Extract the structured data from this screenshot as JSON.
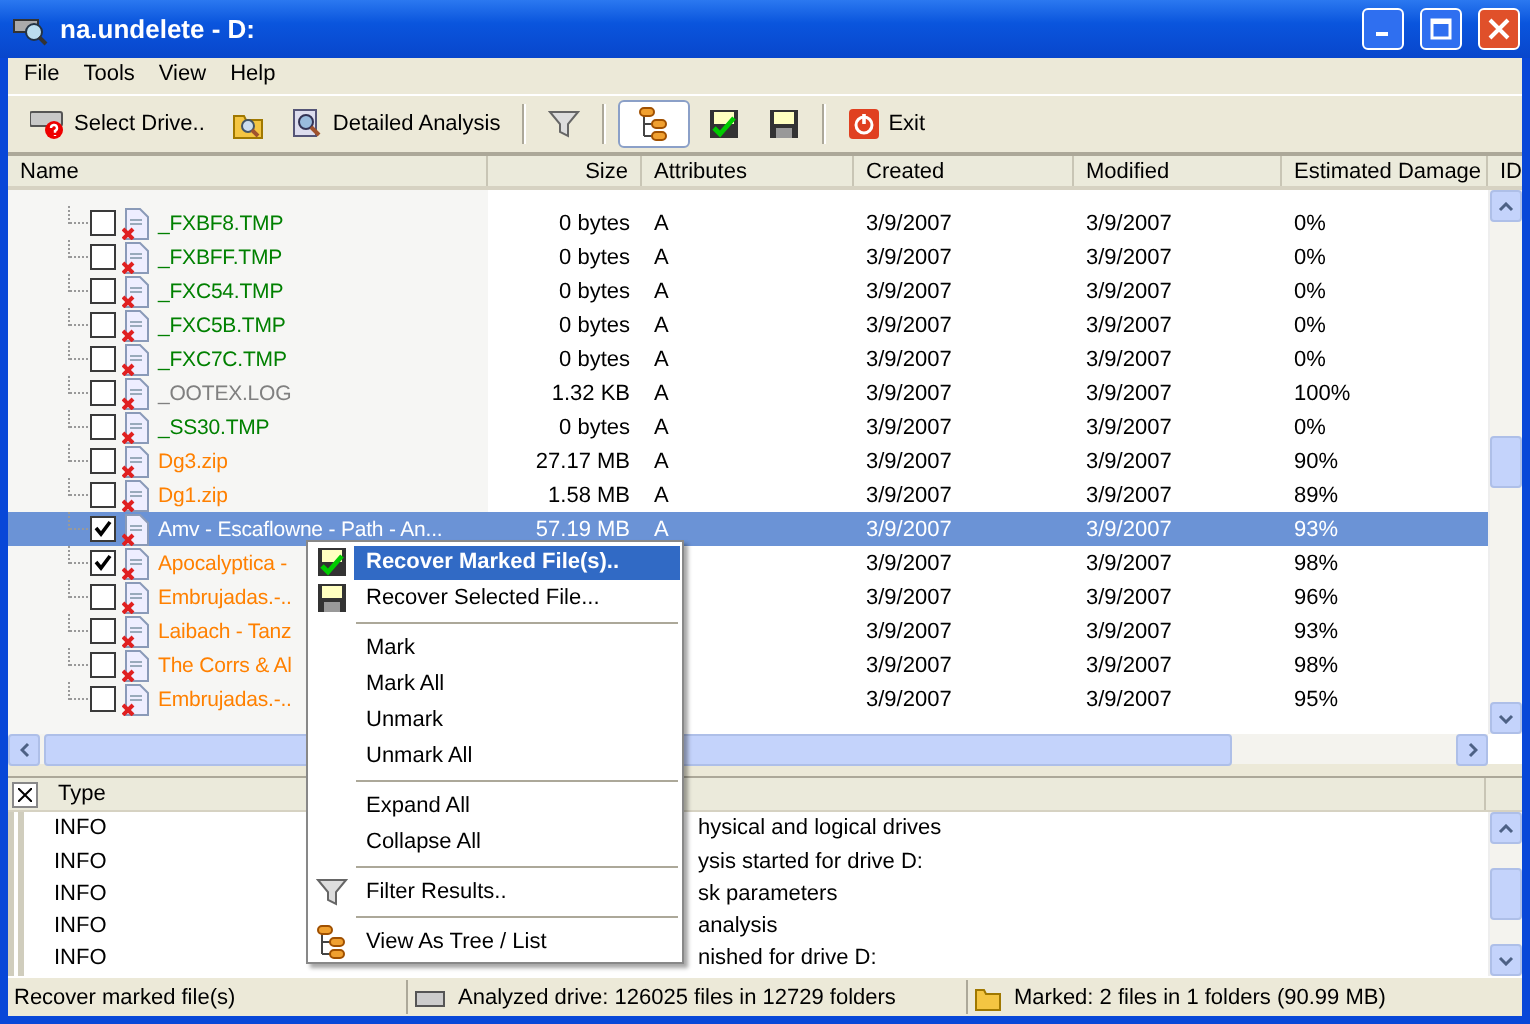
{
  "window": {
    "title": "na.undelete - D:"
  },
  "menu_bar": [
    "File",
    "Tools",
    "View",
    "Help"
  ],
  "toolbar": [
    {
      "kind": "button",
      "label": "Select Drive..",
      "pressed": false
    },
    {
      "kind": "button",
      "pressed": false
    },
    {
      "kind": "button",
      "label": "Detailed Analysis",
      "pressed": false
    },
    {
      "kind": "separator"
    },
    {
      "kind": "button",
      "pressed": false
    },
    {
      "kind": "separator"
    },
    {
      "kind": "button",
      "pressed": true
    },
    {
      "kind": "button",
      "pressed": false
    },
    {
      "kind": "button",
      "pressed": false
    },
    {
      "kind": "separator"
    },
    {
      "kind": "button",
      "label": "Exit",
      "pressed": false
    }
  ],
  "table": {
    "columns": [
      "Name",
      "Size",
      "Attributes",
      "Created",
      "Modified",
      "Estimated Damage",
      "ID"
    ],
    "rows": [
      {
        "name": "_FXBF8.TMP",
        "color": "#008000",
        "checked": false,
        "selected": false,
        "size": "0 bytes",
        "attributes": "A",
        "created": "3/9/2007",
        "modified": "3/9/2007",
        "damage": "0%"
      },
      {
        "name": "_FXBFF.TMP",
        "color": "#008000",
        "checked": false,
        "selected": false,
        "size": "0 bytes",
        "attributes": "A",
        "created": "3/9/2007",
        "modified": "3/9/2007",
        "damage": "0%"
      },
      {
        "name": "_FXC54.TMP",
        "color": "#008000",
        "checked": false,
        "selected": false,
        "size": "0 bytes",
        "attributes": "A",
        "created": "3/9/2007",
        "modified": "3/9/2007",
        "damage": "0%"
      },
      {
        "name": "_FXC5B.TMP",
        "color": "#008000",
        "checked": false,
        "selected": false,
        "size": "0 bytes",
        "attributes": "A",
        "created": "3/9/2007",
        "modified": "3/9/2007",
        "damage": "0%"
      },
      {
        "name": "_FXC7C.TMP",
        "color": "#008000",
        "checked": false,
        "selected": false,
        "size": "0 bytes",
        "attributes": "A",
        "created": "3/9/2007",
        "modified": "3/9/2007",
        "damage": "0%"
      },
      {
        "name": "_OOTEX.LOG",
        "color": "#808080",
        "checked": false,
        "selected": false,
        "size": "1.32 KB",
        "attributes": "A",
        "created": "3/9/2007",
        "modified": "3/9/2007",
        "damage": "100%"
      },
      {
        "name": "_SS30.TMP",
        "color": "#008000",
        "checked": false,
        "selected": false,
        "size": "0 bytes",
        "attributes": "A",
        "created": "3/9/2007",
        "modified": "3/9/2007",
        "damage": "0%"
      },
      {
        "name": "Dg3.zip",
        "color": "#ff8000",
        "checked": false,
        "selected": false,
        "size": "27.17 MB",
        "attributes": "A",
        "created": "3/9/2007",
        "modified": "3/9/2007",
        "damage": "90%"
      },
      {
        "name": "Dg1.zip",
        "color": "#ff8000",
        "checked": false,
        "selected": false,
        "size": "1.58 MB",
        "attributes": "A",
        "created": "3/9/2007",
        "modified": "3/9/2007",
        "damage": "89%"
      },
      {
        "name": "Amv - Escaflowne - Path - An...",
        "checked": true,
        "selected": true,
        "size": "57.19 MB",
        "attributes": "A",
        "created": "3/9/2007",
        "modified": "3/9/2007",
        "damage": "93%"
      },
      {
        "name": "Apocalyptica -",
        "color": "#ff8000",
        "checked": true,
        "selected": false,
        "created": "3/9/2007",
        "modified": "3/9/2007",
        "damage": "98%"
      },
      {
        "name": "Embrujadas.-..",
        "color": "#ff8000",
        "checked": false,
        "selected": false,
        "created": "3/9/2007",
        "modified": "3/9/2007",
        "damage": "96%"
      },
      {
        "name": "Laibach - Tanz",
        "color": "#ff8000",
        "checked": false,
        "selected": false,
        "created": "3/9/2007",
        "modified": "3/9/2007",
        "damage": "93%"
      },
      {
        "name": "The Corrs & Al",
        "color": "#ff8000",
        "checked": false,
        "selected": false,
        "created": "3/9/2007",
        "modified": "3/9/2007",
        "damage": "98%"
      },
      {
        "name": "Embrujadas.-..",
        "color": "#ff8000",
        "checked": false,
        "selected": false,
        "created": "3/9/2007",
        "modified": "3/9/2007",
        "damage": "95%"
      }
    ]
  },
  "log": {
    "columns": [
      "Type"
    ],
    "rows": [
      {
        "type": "INFO",
        "message": "hysical and logical drives"
      },
      {
        "type": "INFO",
        "message": "ysis started for drive D:"
      },
      {
        "type": "INFO",
        "message": "sk parameters"
      },
      {
        "type": "INFO",
        "message": "analysis"
      },
      {
        "type": "INFO",
        "message": "nished for drive D:"
      }
    ]
  },
  "status_bar": [
    "Recover marked file(s)",
    "Analyzed drive: 126025 files in 12729 folders",
    "Marked: 2 files in 1 folders (90.99 MB)"
  ],
  "context_menu": {
    "items": [
      {
        "kind": "item",
        "label": "Recover Marked File(s)..",
        "selected": true,
        "default": true
      },
      {
        "kind": "item",
        "label": "Recover Selected File...",
        "selected": false,
        "default": false
      },
      {
        "kind": "separator"
      },
      {
        "kind": "item",
        "label": "Mark",
        "selected": false,
        "default": false
      },
      {
        "kind": "item",
        "label": "Mark All",
        "selected": false,
        "default": false
      },
      {
        "kind": "item",
        "label": "Unmark",
        "selected": false,
        "default": false
      },
      {
        "kind": "item",
        "label": "Unmark All",
        "selected": false,
        "default": false
      },
      {
        "kind": "separator"
      },
      {
        "kind": "item",
        "label": "Expand All",
        "selected": false,
        "default": false
      },
      {
        "kind": "item",
        "label": "Collapse All",
        "selected": false,
        "default": false
      },
      {
        "kind": "separator"
      },
      {
        "kind": "item",
        "label": "Filter Results..",
        "selected": false,
        "default": false
      },
      {
        "kind": "separator"
      },
      {
        "kind": "item",
        "label": "View As Tree / List",
        "selected": false,
        "default": false
      }
    ]
  }
}
